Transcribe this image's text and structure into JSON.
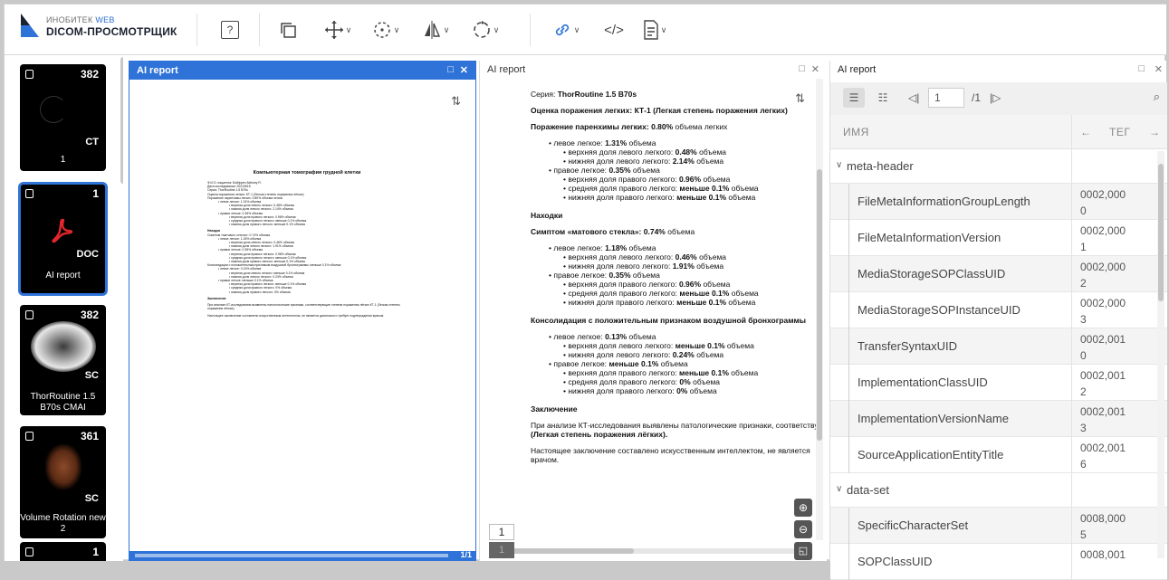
{
  "app": {
    "logo_small": "ИНОБИТЕК",
    "logo_web": "WEB",
    "logo_title": "DICOM-ПРОСМОТРЩИК",
    "help_label": "?"
  },
  "toolbar": {
    "icons": [
      "help-icon",
      "windows-icon",
      "move-icon",
      "rotate-icon",
      "flip-icon",
      "reset-rotate-icon",
      "link-icon",
      "code-icon",
      "document-icon"
    ]
  },
  "sidebar": {
    "items": [
      {
        "count": "382",
        "modality": "CT",
        "number": "1",
        "label": ""
      },
      {
        "count": "1",
        "modality": "DOC",
        "label": "AI report"
      },
      {
        "count": "382",
        "modality": "SC",
        "label": "ThorRoutine 1.5 B70s CMAI"
      },
      {
        "count": "361",
        "modality": "SC",
        "label": "Volume Rotation new 2"
      },
      {
        "count": "1",
        "modality": "",
        "label": ""
      }
    ]
  },
  "panel1": {
    "title": "AI report",
    "page_indicator": "1/1",
    "doc_title": "Компьютерная томография грудной клетки",
    "lines": [
      "Ф.И.О. пациента: Бойфрен Alekney R.",
      "Дата исследования: 20210615",
      "Серия: ThorRoutine 1.5 B70s",
      "Оценка поражения легких: КТ-1 (Легкая степень поражения лёгких)",
      "Поражение паренхимы легких: 0.80% объема легких",
      "• левое легкое: 1.31% объема",
      "• верхняя доля левого легкого: 0.48% объема",
      "• нижняя доля левого легкого: 2.14% объема",
      "• правое легкое: 0.35% объема",
      "• верхняя доля правого легкого: 0.96% объема",
      "• средняя доля правого легкого: меньше 0.1% объема",
      "• нижняя доля правого легкого: меньше 0.1% объема",
      "Находки",
      "Симптом «матового стекла»: 0.74% объема",
      "• левое легкое: 1.18% объема",
      "• верхняя доля левого легкого: 0.46% объема",
      "• нижняя доля левого легкого: 1.91% объема",
      "• правое легкое: 0.35% объема",
      "• верхняя доля правого легкого: 0.96% объема",
      "• средняя доля правого легкого: меньше 0.1% объема",
      "• нижняя доля правого легкого: меньше 0.1% объема",
      "Консолидация с положительным признаком воздушной бронхограммы: меньше 0.1% объема",
      "• левое легкое: 0.13% объема",
      "• верхняя доля левого легкого: меньше 0.1% объема",
      "• нижняя доля левого легкого: 0.24% объема",
      "• правое легкое: меньше 0.1% объема",
      "• верхняя доля правого легкого: меньше 0.1% объема",
      "• средняя доля правого легкого: 0% объема",
      "• нижняя доля правого легкого: 0% объема",
      "Заключение",
      "При анализе КТ-исследования выявлены патологические признаки, соответствующие степени поражения лёгких КТ-1 (Легкая степень поражения лёгких).",
      "Настоящее заключение составлено искусственным интеллектом, не является диагнозом и требует подтверждения врачом."
    ]
  },
  "panel2": {
    "title": "AI report",
    "page_input": "1",
    "page_total": "1",
    "series_label": "Серия:",
    "series_value": "ThorRoutine 1.5 B70s",
    "assessment": "Оценка поражения легких: КТ-1 (Легкая степень поражения легких)",
    "parenchyma_label": "Поражение паренхимы легких:",
    "parenchyma_value": "0.80%",
    "parenchyma_unit": "объема легких",
    "block1": [
      {
        "indent": 0,
        "text": "• левое легкое:",
        "value": "1.31%",
        "unit": "объема"
      },
      {
        "indent": 1,
        "text": "• верхняя доля левого легкого:",
        "value": "0.48%",
        "unit": "объема"
      },
      {
        "indent": 1,
        "text": "• нижняя доля левого легкого:",
        "value": "2.14%",
        "unit": "объема"
      },
      {
        "indent": 0,
        "text": "• правое легкое:",
        "value": "0.35%",
        "unit": "объема"
      },
      {
        "indent": 1,
        "text": "• верхняя доля правого легкого:",
        "value": "0.96%",
        "unit": "объема"
      },
      {
        "indent": 1,
        "text": "• средняя доля правого легкого:",
        "value": "меньше 0.1%",
        "unit": "объема"
      },
      {
        "indent": 1,
        "text": "• нижняя доля правого легкого:",
        "value": "меньше 0.1%",
        "unit": "объема"
      }
    ],
    "findings": "Находки",
    "ggo_label": "Симптом «матового стекла»:",
    "ggo_value": "0.74%",
    "ggo_unit": "объема",
    "block2": [
      {
        "indent": 0,
        "text": "• левое легкое:",
        "value": "1.18%",
        "unit": "объема"
      },
      {
        "indent": 1,
        "text": "• верхняя доля левого легкого:",
        "value": "0.46%",
        "unit": "объема"
      },
      {
        "indent": 1,
        "text": "• нижняя доля левого легкого:",
        "value": "1.91%",
        "unit": "объема"
      },
      {
        "indent": 0,
        "text": "• правое легкое:",
        "value": "0.35%",
        "unit": "объема"
      },
      {
        "indent": 1,
        "text": "• верхняя доля правого легкого:",
        "value": "0.96%",
        "unit": "объема"
      },
      {
        "indent": 1,
        "text": "• средняя доля правого легкого:",
        "value": "меньше 0.1%",
        "unit": "объема"
      },
      {
        "indent": 1,
        "text": "• нижняя доля правого легкого:",
        "value": "меньше 0.1%",
        "unit": "объема"
      }
    ],
    "consolidation": "Консолидация с положительным признаком воздушной бронхограммы",
    "block3": [
      {
        "indent": 0,
        "text": "• левое легкое:",
        "value": "0.13%",
        "unit": "объема"
      },
      {
        "indent": 1,
        "text": "• верхняя доля левого легкого:",
        "value": "меньше 0.1%",
        "unit": "объема"
      },
      {
        "indent": 1,
        "text": "• нижняя доля левого легкого:",
        "value": "0.24%",
        "unit": "объема"
      },
      {
        "indent": 0,
        "text": "• правое легкое:",
        "value": "меньше 0.1%",
        "unit": "объема"
      },
      {
        "indent": 1,
        "text": "• верхняя доля правого легкого:",
        "value": "меньше 0.1%",
        "unit": "объема"
      },
      {
        "indent": 1,
        "text": "• средняя доля правого легкого:",
        "value": "0%",
        "unit": "объема"
      },
      {
        "indent": 1,
        "text": "• нижняя доля правого легкого:",
        "value": "0%",
        "unit": "объема"
      }
    ],
    "conclusion": "Заключение",
    "conclusion_text": "При анализе КТ-исследования выявлены патологические признаки, соответствующие",
    "conclusion_bold": "(Легкая степень поражения лёгких).",
    "disclaimer": "Настоящее заключение составлено искусственным интеллектом, не является",
    "disclaimer2": "врачом."
  },
  "panel3": {
    "title": "AI report",
    "page_input": "1",
    "page_total": "/1",
    "col_name": "ИМЯ",
    "col_tag": "ТЕГ",
    "groups": [
      {
        "name": "meta-header",
        "rows": [
          {
            "name": "FileMetaInformationGroupLength",
            "tag": "0002,000",
            "tag2": "0"
          },
          {
            "name": "FileMetaInformationVersion",
            "tag": "0002,000",
            "tag2": "1"
          },
          {
            "name": "MediaStorageSOPClassUID",
            "tag": "0002,000",
            "tag2": "2"
          },
          {
            "name": "MediaStorageSOPInstanceUID",
            "tag": "0002,000",
            "tag2": "3"
          },
          {
            "name": "TransferSyntaxUID",
            "tag": "0002,001",
            "tag2": "0"
          },
          {
            "name": "ImplementationClassUID",
            "tag": "0002,001",
            "tag2": "2"
          },
          {
            "name": "ImplementationVersionName",
            "tag": "0002,001",
            "tag2": "3"
          },
          {
            "name": "SourceApplicationEntityTitle",
            "tag": "0002,001",
            "tag2": "6"
          }
        ]
      },
      {
        "name": "data-set",
        "rows": [
          {
            "name": "SpecificCharacterSet",
            "tag": "0008,000",
            "tag2": "5"
          },
          {
            "name": "SOPClassUID",
            "tag": "0008,001",
            "tag2": ""
          }
        ]
      }
    ]
  },
  "colors": {
    "accent": "#2f73d8",
    "pdf_red": "#e0272b"
  }
}
